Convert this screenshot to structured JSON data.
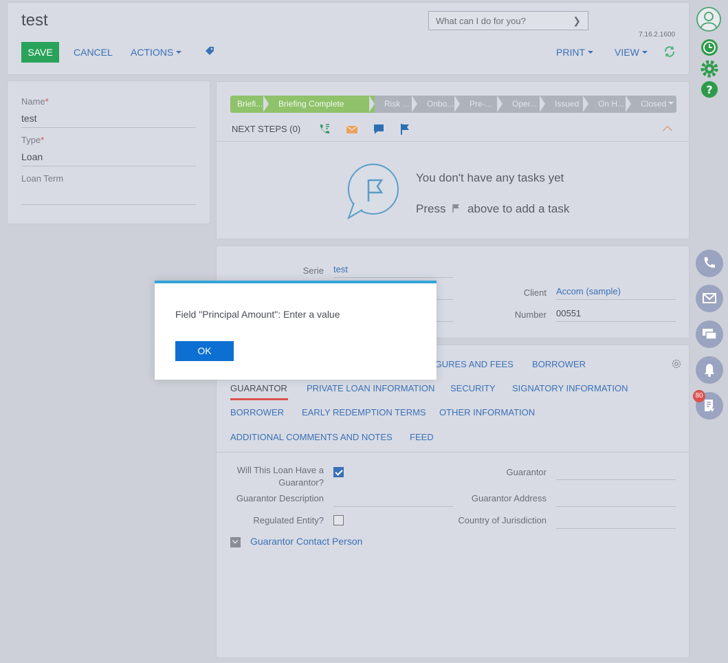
{
  "header": {
    "title": "test",
    "save_label": "SAVE",
    "cancel_label": "CANCEL",
    "actions_label": "ACTIONS",
    "print_label": "PRINT",
    "view_label": "VIEW",
    "search_placeholder": "What can I do for you?",
    "version": "7.16.2.1600"
  },
  "left_panel": {
    "name_label": "Name",
    "name_value": "test",
    "type_label": "Type",
    "type_value": "Loan",
    "term_label": "Loan Term",
    "term_value": ""
  },
  "stages": {
    "items": [
      {
        "label": "Briefi...",
        "done": true
      },
      {
        "label": "Briefing Complete",
        "done": true
      },
      {
        "label": "Risk ...",
        "done": false
      },
      {
        "label": "Onbo...",
        "done": false
      },
      {
        "label": "Pre-...",
        "done": false
      },
      {
        "label": "Oper...",
        "done": false
      },
      {
        "label": "Issued",
        "done": false
      },
      {
        "label": "On H...",
        "done": false
      },
      {
        "label": "Closed",
        "done": false
      }
    ]
  },
  "next_steps": {
    "label": "NEXT STEPS (0)",
    "empty_title": "You don't have any tasks yet",
    "empty_press": "Press",
    "empty_rest": "above to add a task"
  },
  "record": {
    "serie_label": "Serie",
    "serie_value": "test",
    "client_label": "Client",
    "client_value": "Accom (sample)",
    "number_label": "Number",
    "number_value": "00551"
  },
  "tabs": {
    "row1": [
      {
        "label": "IGURES AND FEES"
      },
      {
        "label": "BORROWER"
      }
    ],
    "row2": [
      {
        "label": "GUARANTOR"
      },
      {
        "label": "PRIVATE LOAN INFORMATION"
      },
      {
        "label": "SECURITY"
      },
      {
        "label": "SIGNATORY INFORMATION"
      }
    ],
    "row3": [
      {
        "label": "BORROWER"
      },
      {
        "label": "EARLY REDEMPTION TERMS"
      },
      {
        "label": "OTHER INFORMATION"
      }
    ],
    "row4": [
      {
        "label": "ADDITIONAL COMMENTS AND NOTES"
      },
      {
        "label": "FEED"
      }
    ]
  },
  "guarantor": {
    "have_label_1": "Will This Loan Have a",
    "have_label_2": "Guarantor?",
    "have_checked": true,
    "guarantor_label": "Guarantor",
    "desc_label": "Guarantor Description",
    "address_label": "Guarantor Address",
    "regulated_label": "Regulated Entity?",
    "regulated_checked": false,
    "country_label": "Country of Jurisdiction",
    "contact_group_label": "Guarantor Contact Person"
  },
  "rail": {
    "notification_count": "80"
  },
  "modal": {
    "message": "Field \"Principal Amount\": Enter a value",
    "ok_label": "OK"
  },
  "colors": {
    "save_green": "#2aa35a",
    "link_blue": "#3b71b6",
    "stage_done": "#8fc26a",
    "modal_accent": "#35a3d9",
    "ok_blue": "#0d6fd1",
    "badge_red": "#d9534f"
  }
}
